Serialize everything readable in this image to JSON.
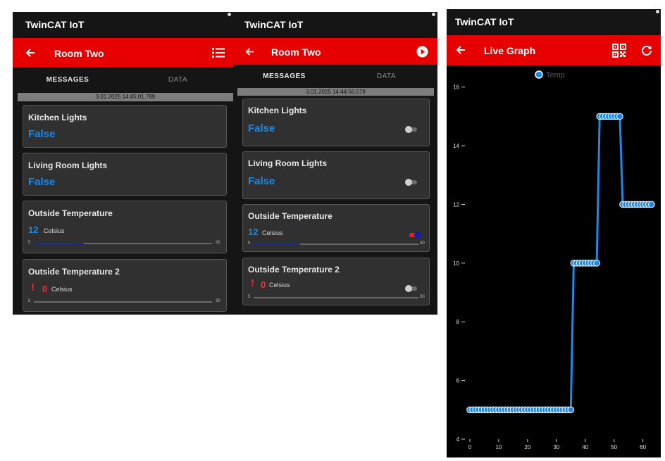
{
  "colors": {
    "accent": "#e60000",
    "value": "#1e88e5",
    "error": "#ff2b2b",
    "background": "#151515",
    "card": "#303030",
    "series": "#1e88e5"
  },
  "screen1": {
    "app_title": "TwinCAT IoT",
    "toolbar": {
      "back_icon": "arrow-left-icon",
      "title": "Room Two",
      "action_icon": "list-icon"
    },
    "tabs": {
      "messages": "MESSAGES",
      "data": "DATA"
    },
    "timestamp": "3.01.2025 14:45:01.789",
    "cards": [
      {
        "title": "Kitchen Lights",
        "value": "False"
      },
      {
        "title": "Living Room Lights",
        "value": "False"
      },
      {
        "title": "Outside Temperature",
        "value": "12",
        "unit": "Celsius",
        "min": "5",
        "max": "30",
        "level": 0.28
      },
      {
        "title": "Outside Temperature 2",
        "value": "0",
        "unit": "Celsius",
        "min": "5",
        "max": "30",
        "level": 0
      }
    ]
  },
  "screen2": {
    "app_title": "TwinCAT IoT",
    "toolbar": {
      "back_icon": "arrow-left-icon",
      "title": "Room Two",
      "action_icon": "play-icon"
    },
    "tabs": {
      "messages": "MESSAGES",
      "data": "DATA"
    },
    "timestamp": "3.01.2025 14:44:56.579",
    "cards": [
      {
        "title": "Kitchen Lights",
        "value": "False",
        "toggle": false
      },
      {
        "title": "Living Room Lights",
        "value": "False",
        "toggle": false
      },
      {
        "title": "Outside Temperature",
        "value": "12",
        "unit": "Celsius",
        "min": "5",
        "max": "30",
        "level": 0.28,
        "toggle": true
      },
      {
        "title": "Outside Temperature 2",
        "value": "0",
        "unit": "Celsius",
        "min": "5",
        "max": "30",
        "level": 0,
        "toggle": false
      }
    ]
  },
  "screen3": {
    "app_title": "TwinCAT IoT",
    "toolbar": {
      "back_icon": "arrow-left-icon",
      "title": "Live Graph",
      "qr_icon": "qr-code-icon",
      "refresh_icon": "refresh-icon"
    },
    "legend_label": "Temp"
  },
  "chart_data": {
    "type": "line",
    "title": "",
    "xlabel": "",
    "ylabel": "",
    "xlim": [
      0,
      64
    ],
    "ylim": [
      4,
      16.4
    ],
    "x_ticks": [
      0,
      10,
      20,
      30,
      40,
      50,
      60
    ],
    "y_ticks": [
      4,
      6,
      8,
      10,
      12,
      14,
      16
    ],
    "legend": "top-center",
    "series": [
      {
        "name": "Temp",
        "color": "#1e88e5",
        "x": [
          0,
          1,
          2,
          3,
          4,
          5,
          6,
          7,
          8,
          9,
          10,
          11,
          12,
          13,
          14,
          15,
          16,
          17,
          18,
          19,
          20,
          21,
          22,
          23,
          24,
          25,
          26,
          27,
          28,
          29,
          30,
          31,
          32,
          33,
          34,
          35,
          36,
          37,
          38,
          39,
          40,
          41,
          42,
          43,
          44,
          45,
          46,
          47,
          48,
          49,
          50,
          51,
          52,
          53,
          54,
          55,
          56,
          57,
          58,
          59,
          60,
          61,
          62,
          63
        ],
        "y": [
          5,
          5,
          5,
          5,
          5,
          5,
          5,
          5,
          5,
          5,
          5,
          5,
          5,
          5,
          5,
          5,
          5,
          5,
          5,
          5,
          5,
          5,
          5,
          5,
          5,
          5,
          5,
          5,
          5,
          5,
          5,
          5,
          5,
          5,
          5,
          5,
          10,
          10,
          10,
          10,
          10,
          10,
          10,
          10,
          10,
          15,
          15,
          15,
          15,
          15,
          15,
          15,
          15,
          12,
          12,
          12,
          12,
          12,
          12,
          12,
          12,
          12,
          12,
          12
        ]
      }
    ]
  }
}
